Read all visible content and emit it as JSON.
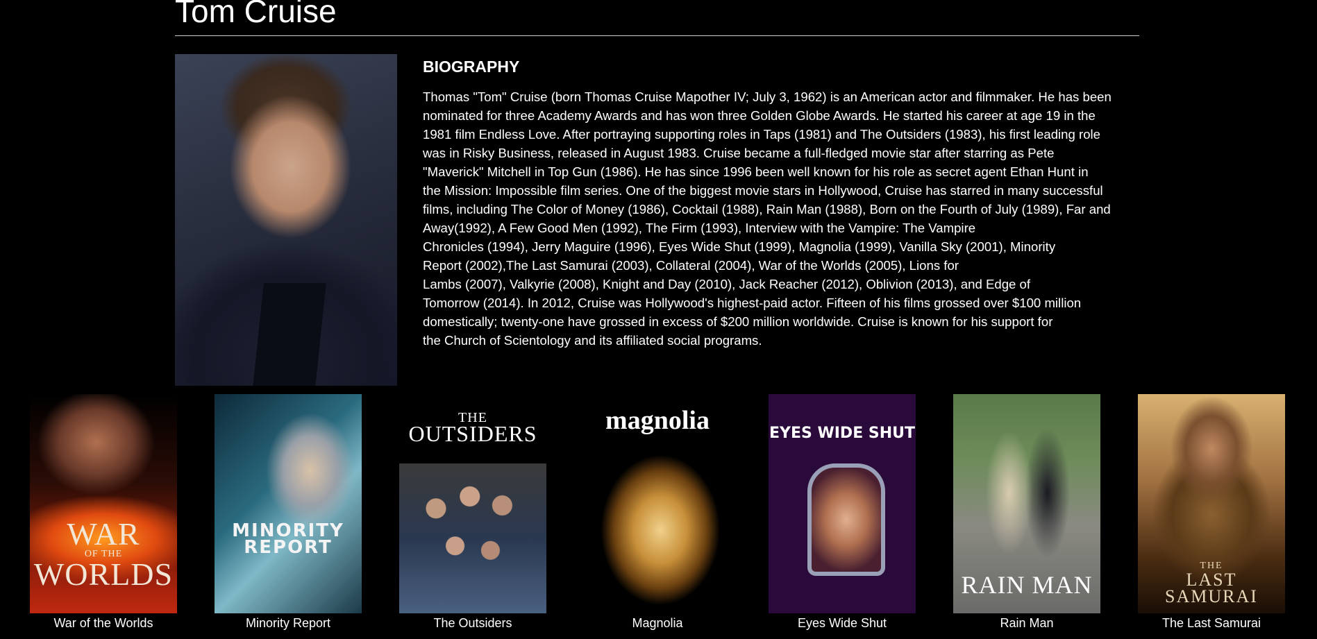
{
  "page": {
    "title": "Tom Cruise"
  },
  "biography": {
    "heading": "BIOGRAPHY",
    "lines": [
      "Thomas \"Tom\" Cruise (born Thomas Cruise Mapother IV; July 3, 1962) is an American actor and filmmaker. He has been",
      "nominated for three Academy Awards and has won three Golden Globe Awards. He started his career at age 19 in the",
      "1981 film Endless Love. After portraying supporting roles in Taps (1981) and The Outsiders (1983), his first leading role",
      "was in Risky Business, released in August 1983. Cruise became a full-fledged movie star after starring as Pete",
      "\"Maverick\" Mitchell in Top Gun (1986). He has since 1996 been well known for his role as secret agent Ethan Hunt in",
      "the Mission: Impossible film series. One of the biggest movie stars in Hollywood, Cruise has starred in many successful",
      "films, including The Color of Money (1986), Cocktail (1988), Rain Man (1988), Born on the Fourth of July (1989), Far and",
      "Away(1992), A Few Good Men (1992), The Firm (1993), Interview with the Vampire: The Vampire",
      "Chronicles (1994), Jerry Maguire (1996), Eyes Wide Shut (1999), Magnolia (1999), Vanilla Sky (2001), Minority",
      "Report (2002),The Last Samurai (2003), Collateral (2004), War of the Worlds (2005), Lions for",
      "Lambs (2007), Valkyrie (2008), Knight and Day (2010), Jack Reacher (2012), Oblivion (2013), and Edge of",
      "Tomorrow (2014). In 2012, Cruise was Hollywood's highest-paid actor. Fifteen of his films grossed over $100 million",
      "domestically; twenty-one have grossed in excess of $200 million worldwide. Cruise is known for his support for",
      "the Church of Scientology and its affiliated social programs."
    ]
  },
  "movies": [
    {
      "caption": "War of the Worlds",
      "poster_text": "WAR",
      "poster_small": "OF THE",
      "poster_text2": "WORLDS"
    },
    {
      "caption": "Minority Report",
      "poster_text": "MINORITY",
      "poster_text2": "REPORT"
    },
    {
      "caption": "The Outsiders",
      "poster_small": "THE",
      "poster_text": "OUTSIDERS"
    },
    {
      "caption": "Magnolia",
      "poster_text": "magnolia"
    },
    {
      "caption": "Eyes Wide Shut",
      "poster_text": "EYES WIDE SHUT"
    },
    {
      "caption": "Rain Man",
      "poster_text": "RAIN MAN"
    },
    {
      "caption": "The Last Samurai",
      "poster_small": "THE",
      "poster_text": "LAST",
      "poster_text2": "SAMURAI"
    }
  ],
  "icons": {
    "portrait": "actor-portrait-photo"
  }
}
